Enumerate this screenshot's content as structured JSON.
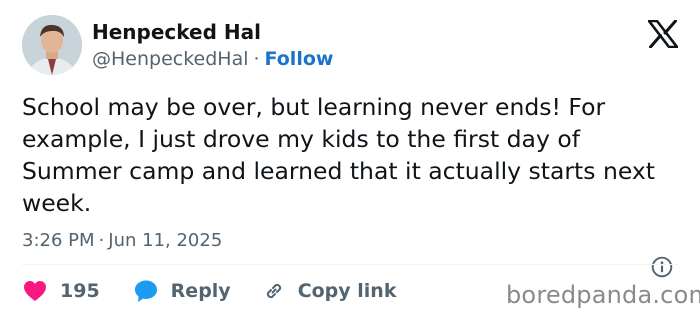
{
  "author": {
    "name": "Henpecked Hal",
    "handle": "@HenpeckedHal",
    "separator": "·",
    "follow_label": "Follow"
  },
  "tweet": {
    "text": "School may be over, but learning never ends! For example, I just drove my kids to the first day of Summer camp and learned that it actually starts next week.",
    "time": "3:26 PM",
    "separator": "·",
    "date": "Jun 11, 2025"
  },
  "actions": {
    "like_count": "195",
    "reply_label": "Reply",
    "copy_label": "Copy link"
  },
  "icons": [
    "avatar",
    "x-logo-icon",
    "info-icon",
    "heart-icon",
    "reply-bubble-icon",
    "link-icon"
  ],
  "colors": {
    "like": "#f91880",
    "reply": "#1d9bf0",
    "follow": "#1d73c9",
    "muted": "#536471"
  },
  "watermark": "boredpanda.com"
}
